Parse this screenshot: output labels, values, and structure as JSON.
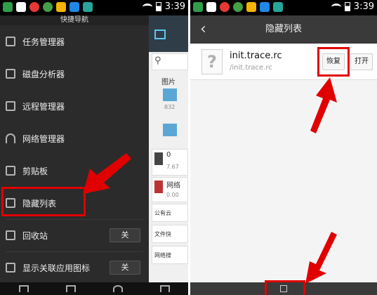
{
  "left": {
    "status_time": "3:39",
    "drawer_title": "快捷导航",
    "items": [
      {
        "label": "任务管理器"
      },
      {
        "label": "磁盘分析器"
      },
      {
        "label": "远程管理器"
      },
      {
        "label": "网络管理器"
      },
      {
        "label": "剪贴板"
      },
      {
        "label": "隐藏列表"
      },
      {
        "label": "回收站",
        "button": "关"
      },
      {
        "label": "显示关联应用图标",
        "button": "关"
      }
    ],
    "peek": {
      "pictures": "图片",
      "count": "832",
      "storage_value": "0",
      "storage_sub": "7.67",
      "network": "网络",
      "network_sub": "0.00",
      "public_cloud": "公有云",
      "file_fast": "文件快",
      "network_search": "网络搜"
    }
  },
  "right": {
    "status_time": "3:39",
    "title": "隐藏列表",
    "back_icon": "‹",
    "file": {
      "name": "init.trace.rc",
      "path": "/init.trace.rc",
      "restore": "恢复",
      "open": "打开"
    }
  },
  "colors": {
    "highlight": "#e00000"
  }
}
